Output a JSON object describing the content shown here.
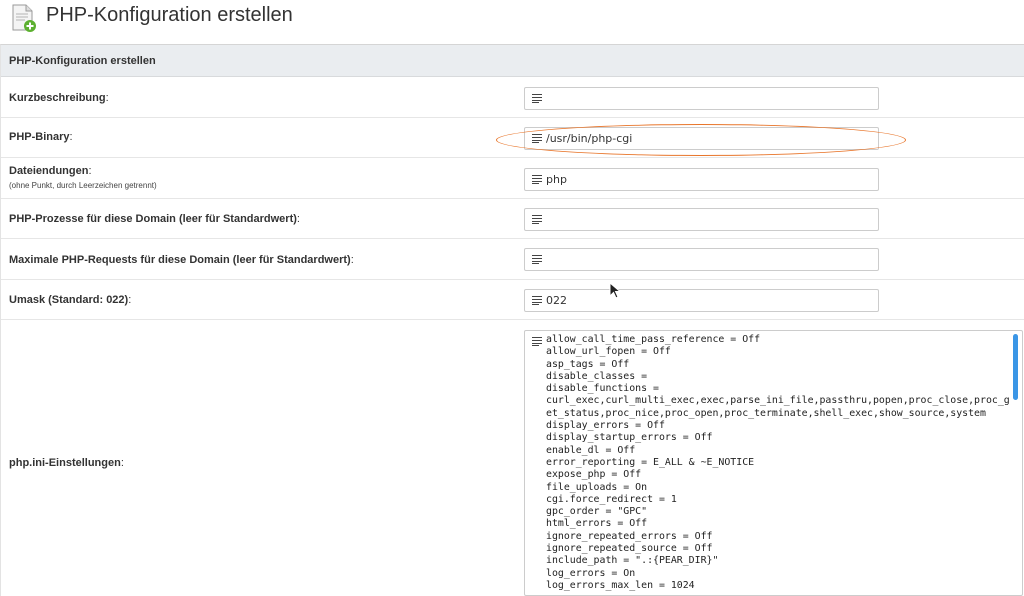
{
  "page": {
    "title": "PHP-Konfiguration erstellen",
    "icon": "document-add-icon"
  },
  "form": {
    "heading": "PHP-Konfiguration erstellen",
    "short_description": {
      "label": "Kurzbeschreibung",
      "suffix": ":",
      "value": ""
    },
    "binary": {
      "label": "PHP-Binary",
      "suffix": ":",
      "value": "/usr/bin/php-cgi"
    },
    "extensions": {
      "label": "Dateiendungen",
      "suffix": ":",
      "hint": "(ohne Punkt, durch Leerzeichen getrennt)",
      "value": "php"
    },
    "processes": {
      "label": "PHP-Prozesse für diese Domain (leer für Standardwert)",
      "suffix": ":",
      "value": ""
    },
    "max_requests": {
      "label": "Maximale PHP-Requests für diese Domain (leer für Standardwert)",
      "suffix": ":",
      "value": ""
    },
    "umask": {
      "label": "Umask (Standard: 022)",
      "suffix": ":",
      "value": "022"
    },
    "ini_settings": {
      "label": "php.ini-Einstellungen",
      "suffix": ":",
      "value": "allow_call_time_pass_reference = Off\nallow_url_fopen = Off\nasp_tags = Off\ndisable_classes =\ndisable_functions = \ncurl_exec,curl_multi_exec,exec,parse_ini_file,passthru,popen,proc_close,proc_get_status,proc_nice,proc_open,proc_terminate,shell_exec,show_source,system\ndisplay_errors = Off\ndisplay_startup_errors = Off\nenable_dl = Off\nerror_reporting = E_ALL & ~E_NOTICE\nexpose_php = Off\nfile_uploads = On\ncgi.force_redirect = 1\ngpc_order = \"GPC\"\nhtml_errors = Off\nignore_repeated_errors = Off\nignore_repeated_source = Off\ninclude_path = \".:{PEAR_DIR}\"\nlog_errors = On\nlog_errors_max_len = 1024"
    }
  },
  "colors": {
    "annotation": "#e8752a",
    "scrollbar": "#3b96e6",
    "panel_heading_bg": "#eaedf0"
  }
}
